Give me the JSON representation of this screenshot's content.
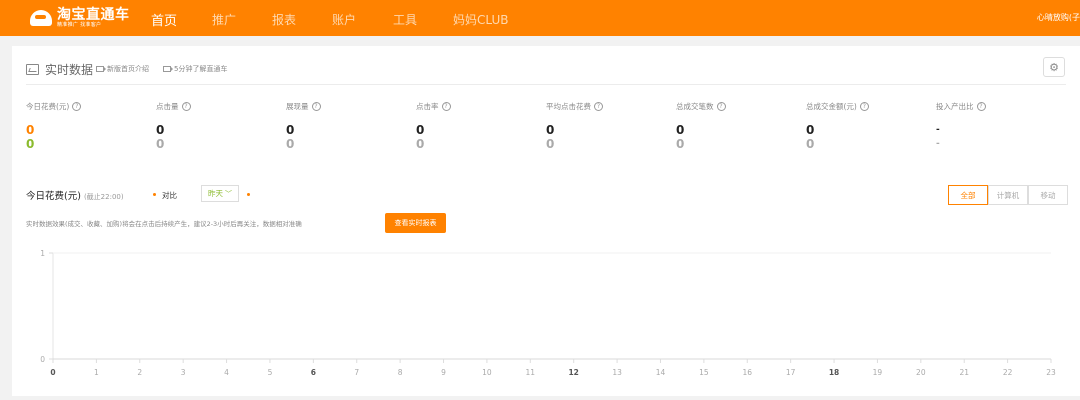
{
  "nav": {
    "logo_main": "淘宝直通车",
    "logo_sub": "精准推广 找准客户",
    "items": [
      "首页",
      "推广",
      "报表",
      "账户",
      "工具",
      "妈妈CLUB"
    ],
    "user": "心晴放购(子"
  },
  "realtime": {
    "title": "实时数据",
    "link1": "新版首页介绍",
    "link2": "5分钟了解直通车"
  },
  "metrics": [
    {
      "label": "今日花费(元)",
      "today": "0",
      "yesterday": "0"
    },
    {
      "label": "点击量",
      "today": "0",
      "yesterday": "0"
    },
    {
      "label": "展现量",
      "today": "0",
      "yesterday": "0"
    },
    {
      "label": "点击率",
      "today": "0",
      "yesterday": "0"
    },
    {
      "label": "平均点击花费",
      "today": "0",
      "yesterday": "0"
    },
    {
      "label": "总成交笔数",
      "today": "0",
      "yesterday": "0"
    },
    {
      "label": "总成交金额(元)",
      "today": "0",
      "yesterday": "0"
    },
    {
      "label": "投入产出比",
      "today": "-",
      "yesterday": "-"
    }
  ],
  "chart_header": {
    "title": "今日花费(元)",
    "note": "(截止22:00)",
    "compare_label": "对比",
    "compare_value": "昨天",
    "segments": [
      "全部",
      "计算机",
      "移动"
    ],
    "hint": "实时数据效果(成交、收藏、加购)将会在点击后持续产生，建议2-3小时后再关注，数据相对准确",
    "report_button": "查看实时报表"
  },
  "colors": {
    "brand": "#ff8200",
    "compare_green": "#8bbb2e"
  },
  "chart_data": {
    "type": "line",
    "x": [
      0,
      1,
      2,
      3,
      4,
      5,
      6,
      7,
      8,
      9,
      10,
      11,
      12,
      13,
      14,
      15,
      16,
      17,
      18,
      19,
      20,
      21,
      22,
      23
    ],
    "series": [],
    "yticks": [
      0,
      1
    ],
    "ylim": [
      0,
      1
    ],
    "bold_ticks": [
      0,
      6,
      12,
      18
    ],
    "xlabel": "",
    "ylabel": "",
    "grid": false
  }
}
